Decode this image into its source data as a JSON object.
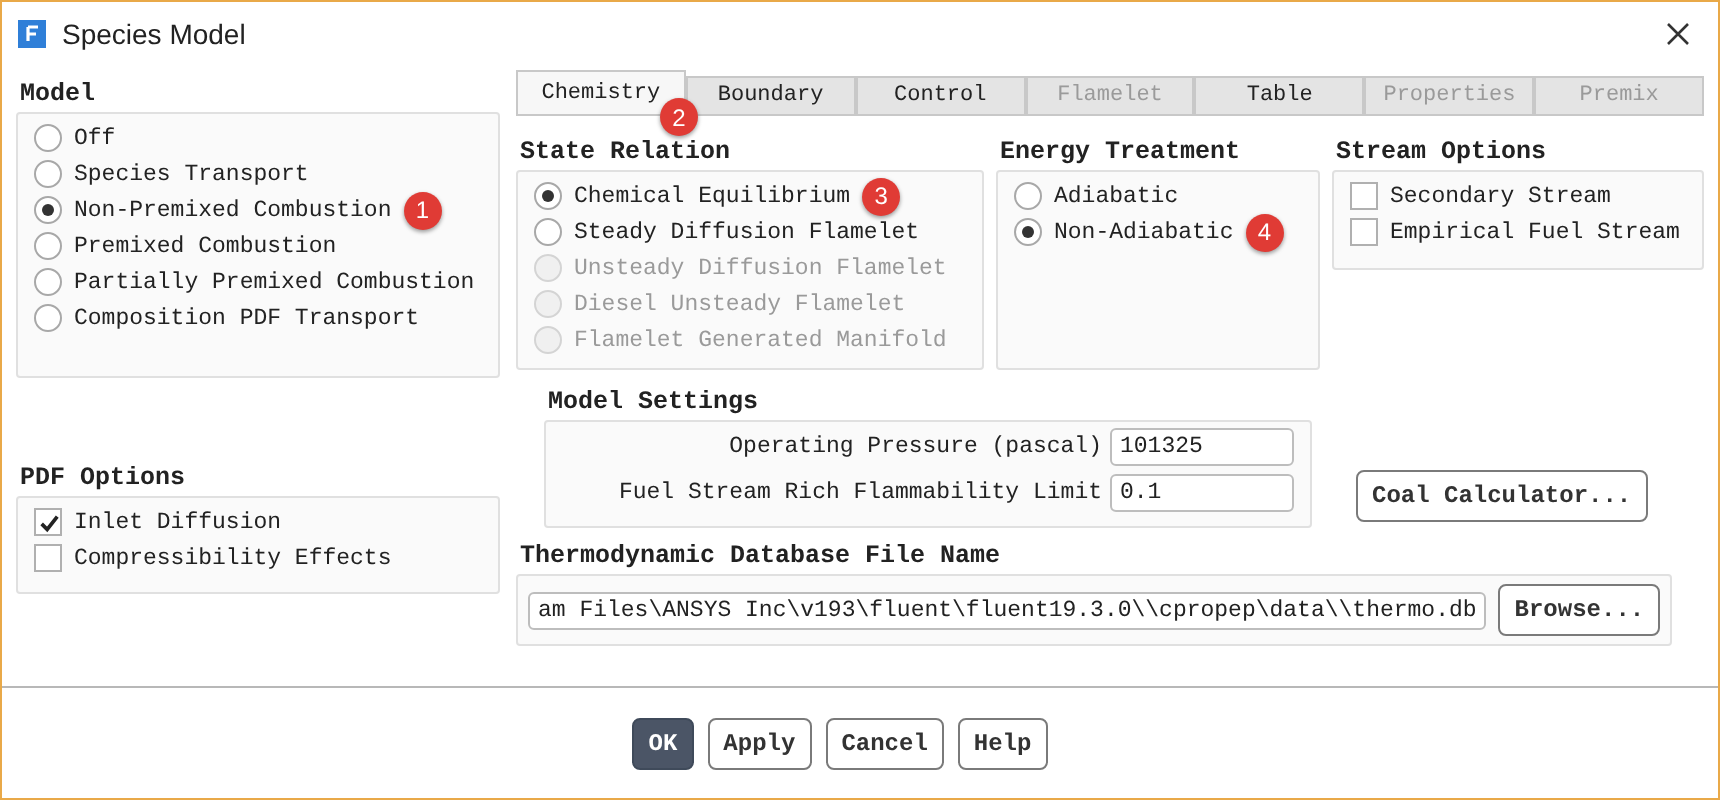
{
  "window": {
    "title": "Species Model"
  },
  "model": {
    "title": "Model",
    "options": [
      {
        "label": "Off",
        "selected": false
      },
      {
        "label": "Species Transport",
        "selected": false
      },
      {
        "label": "Non-Premixed Combustion",
        "selected": true,
        "annotation": "1"
      },
      {
        "label": "Premixed Combustion",
        "selected": false
      },
      {
        "label": "Partially Premixed Combustion",
        "selected": false
      },
      {
        "label": "Composition PDF Transport",
        "selected": false
      }
    ]
  },
  "pdf_options": {
    "title": "PDF Options",
    "items": [
      {
        "label": "Inlet Diffusion",
        "checked": true
      },
      {
        "label": "Compressibility Effects",
        "checked": false
      }
    ]
  },
  "tabs": [
    {
      "label": "Chemistry",
      "selected": true,
      "disabled": false,
      "annotation": "2"
    },
    {
      "label": "Boundary",
      "selected": false,
      "disabled": false
    },
    {
      "label": "Control",
      "selected": false,
      "disabled": false
    },
    {
      "label": "Flamelet",
      "selected": false,
      "disabled": true
    },
    {
      "label": "Table",
      "selected": false,
      "disabled": false
    },
    {
      "label": "Properties",
      "selected": false,
      "disabled": true
    },
    {
      "label": "Premix",
      "selected": false,
      "disabled": true
    }
  ],
  "state_relation": {
    "title": "State Relation",
    "options": [
      {
        "label": "Chemical Equilibrium",
        "selected": true,
        "disabled": false,
        "annotation": "3"
      },
      {
        "label": "Steady Diffusion Flamelet",
        "selected": false,
        "disabled": false
      },
      {
        "label": "Unsteady Diffusion Flamelet",
        "selected": false,
        "disabled": true
      },
      {
        "label": "Diesel Unsteady Flamelet",
        "selected": false,
        "disabled": true
      },
      {
        "label": "Flamelet Generated Manifold",
        "selected": false,
        "disabled": true
      }
    ]
  },
  "energy_treatment": {
    "title": "Energy Treatment",
    "options": [
      {
        "label": "Adiabatic",
        "selected": false,
        "disabled": false
      },
      {
        "label": "Non-Adiabatic",
        "selected": true,
        "disabled": false,
        "annotation": "4"
      }
    ]
  },
  "stream_options": {
    "title": "Stream Options",
    "items": [
      {
        "label": "Secondary Stream",
        "checked": false
      },
      {
        "label": "Empirical Fuel Stream",
        "checked": false
      }
    ]
  },
  "model_settings": {
    "title": "Model Settings",
    "fields": [
      {
        "label": "Operating Pressure (pascal)",
        "value": "101325"
      },
      {
        "label": "Fuel Stream Rich Flammability Limit",
        "value": "0.1"
      }
    ]
  },
  "coal_calculator": "Coal Calculator...",
  "thermo_db": {
    "title": "Thermodynamic Database File Name",
    "value": "am Files\\ANSYS Inc\\v193\\fluent\\fluent19.3.0\\\\cpropep\\data\\\\thermo.db",
    "button": "Browse..."
  },
  "buttons": [
    {
      "label": "OK",
      "default": true
    },
    {
      "label": "Apply",
      "default": false
    },
    {
      "label": "Cancel",
      "default": false
    },
    {
      "label": "Help",
      "default": false
    }
  ]
}
